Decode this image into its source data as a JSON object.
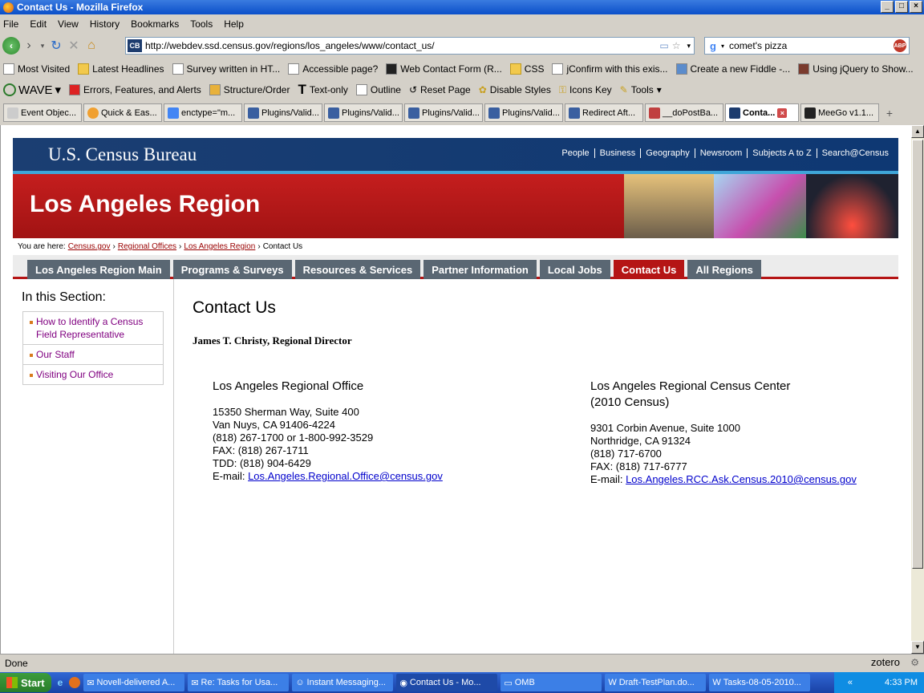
{
  "window": {
    "title": "Contact Us - Mozilla Firefox"
  },
  "menu": [
    "File",
    "Edit",
    "View",
    "History",
    "Bookmarks",
    "Tools",
    "Help"
  ],
  "url": "http://webdev.ssd.census.gov/regions/los_angeles/www/contact_us/",
  "search": "comet's pizza",
  "bookmarks": [
    "Most Visited",
    "Latest Headlines",
    "Survey written in HT...",
    "Accessible page?",
    "Web Contact Form (R...",
    "CSS",
    "jConfirm with this exis...",
    "Create a new Fiddle -...",
    "Using jQuery to Show..."
  ],
  "wave": {
    "name": "WAVE",
    "items": [
      "Errors, Features, and Alerts",
      "Structure/Order",
      "Text-only",
      "Outline",
      "Reset Page",
      "Disable Styles",
      "Icons Key",
      "Tools"
    ]
  },
  "tabs": [
    "Event Objec...",
    "Quick & Eas...",
    "enctype=\"m...",
    "Plugins/Valid...",
    "Plugins/Valid...",
    "Plugins/Valid...",
    "Plugins/Valid...",
    "Redirect Aft...",
    "__doPostBa...",
    "Conta...",
    "MeeGo v1.1..."
  ],
  "site": {
    "brand": "U.S. Census Bureau",
    "topnav": [
      "People",
      "Business",
      "Geography",
      "Newsroom",
      "Subjects A to Z",
      "Search@Census"
    ],
    "region": "Los Angeles Region",
    "breadcrumb": {
      "label": "You are here:",
      "links": [
        "Census.gov",
        "Regional Offices",
        "Los Angeles Region"
      ],
      "current": "Contact Us",
      "sep": "›"
    },
    "nav": [
      "Los Angeles Region Main",
      "Programs & Surveys",
      "Resources & Services",
      "Partner Information",
      "Local Jobs",
      "Contact Us",
      "All Regions"
    ],
    "section_title": "In this Section:",
    "sidelinks": [
      "How to Identify a Census Field Representative",
      "Our Staff",
      "Visiting Our Office"
    ],
    "page_title": "Contact Us",
    "director": "James T. Christy, Regional Director",
    "office1": {
      "title": "Los Angeles Regional Office",
      "lines": [
        "15350 Sherman Way, Suite 400",
        "Van Nuys, CA 91406-4224",
        "(818) 267-1700 or 1-800-992-3529",
        "FAX: (818) 267-1711",
        "TDD: (818) 904-6429"
      ],
      "email_label": "E-mail:",
      "email": "Los.Angeles.Regional.Office@census.gov"
    },
    "office2": {
      "title_line1": "Los Angeles Regional Census Center",
      "title_line2": "(2010 Census)",
      "lines": [
        "9301 Corbin Avenue, Suite 1000",
        "Northridge, CA 91324",
        "(818) 717-6700",
        "FAX: (818) 717-6777"
      ],
      "email_label": "E-mail:",
      "email": "Los.Angeles.RCC.Ask.Census.2010@census.gov"
    }
  },
  "status": "Done",
  "zotero": "zotero",
  "taskbar": {
    "start": "Start",
    "items": [
      "Novell-delivered A...",
      "Re: Tasks for Usa...",
      "Instant Messaging...",
      "Contact Us - Mo...",
      "OMB",
      "Draft-TestPlan.do...",
      "Tasks-08-05-2010..."
    ],
    "time": "4:33 PM"
  }
}
